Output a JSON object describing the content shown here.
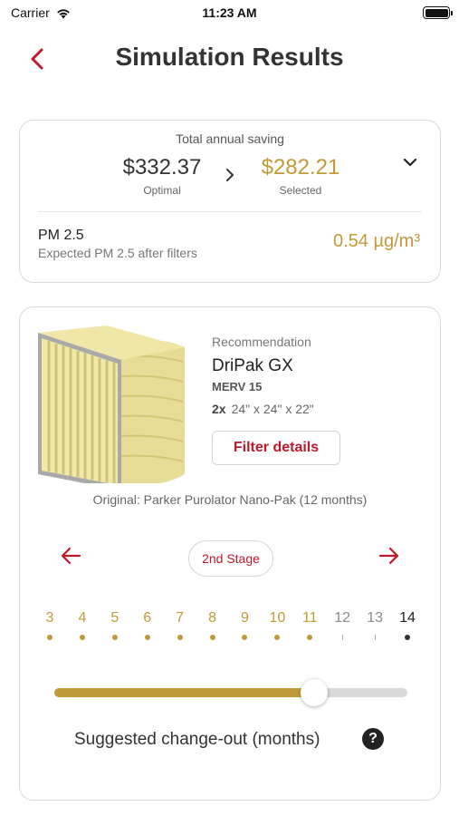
{
  "status_bar": {
    "carrier": "Carrier",
    "time": "11:23 AM",
    "icons": [
      "wifi-icon",
      "battery-icon"
    ]
  },
  "header": {
    "title": "Simulation Results",
    "back_icon": "chevron-left-icon"
  },
  "savings": {
    "title": "Total annual saving",
    "optimal": {
      "value": "$332.37",
      "label": "Optimal"
    },
    "selected": {
      "value": "$282.21",
      "label": "Selected"
    },
    "pm": {
      "label": "PM 2.5",
      "sublabel": "Expected PM 2.5 after filters",
      "value": "0.54 µg/m³"
    }
  },
  "recommendation": {
    "label": "Recommendation",
    "product": "DriPak GX",
    "merv": "MERV 15",
    "quantity": "2x",
    "size": "24\" x 24\" x 22\"",
    "details_button": "Filter details",
    "original": "Original: Parker Purolator Nano-Pak (12 months)",
    "stage": "2nd Stage",
    "months": [
      {
        "label": "3",
        "state": "active"
      },
      {
        "label": "4",
        "state": "active"
      },
      {
        "label": "5",
        "state": "active"
      },
      {
        "label": "6",
        "state": "active"
      },
      {
        "label": "7",
        "state": "active"
      },
      {
        "label": "8",
        "state": "active"
      },
      {
        "label": "9",
        "state": "active"
      },
      {
        "label": "10",
        "state": "active"
      },
      {
        "label": "11",
        "state": "active"
      },
      {
        "label": "12",
        "state": "inactive"
      },
      {
        "label": "13",
        "state": "inactive"
      },
      {
        "label": "14",
        "state": "current"
      }
    ],
    "slider_value_months": 11,
    "slider_min": 3,
    "slider_max": 14,
    "changeout_label": "Suggested change-out (months)"
  },
  "colors": {
    "accent_red": "#c0182b",
    "accent_gold": "#c19a3a"
  }
}
